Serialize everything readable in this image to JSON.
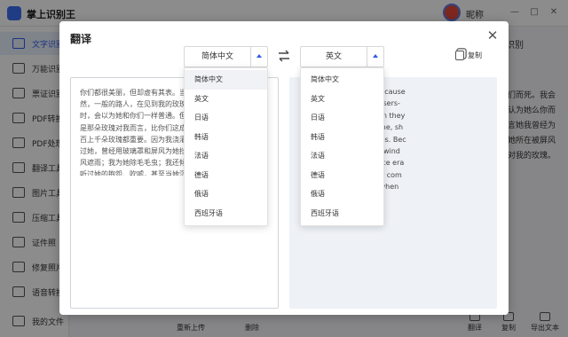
{
  "app": {
    "title": "掌上识别王",
    "user_name": "昵称",
    "window_buttons": [
      "—",
      "□",
      "✕"
    ]
  },
  "sidebar": {
    "items": [
      {
        "label": "文字识别",
        "icon": "text-recognition-icon",
        "active": true
      },
      {
        "label": "万能识别",
        "icon": "universal-recognition-icon"
      },
      {
        "label": "票证识别",
        "icon": "ticket-recognition-icon"
      },
      {
        "label": "PDF转换",
        "icon": "pdf-convert-icon"
      },
      {
        "label": "PDF处理",
        "icon": "pdf-process-icon"
      },
      {
        "label": "翻译工具",
        "icon": "translate-tool-icon"
      },
      {
        "label": "图片工具",
        "icon": "image-tool-icon"
      },
      {
        "label": "压缩工具",
        "icon": "compress-tool-icon"
      },
      {
        "label": "证件照",
        "icon": "id-photo-icon"
      },
      {
        "label": "修复照片",
        "icon": "photo-repair-icon"
      },
      {
        "label": "语音转换",
        "icon": "voice-convert-icon"
      }
    ],
    "bottom_label": "我的文件"
  },
  "main": {
    "tab_right": "识别",
    "right_panel_text": "们而死。我会认为她么你而言她我曾经为她所在被屏风对我的玫瑰。",
    "bottom": {
      "reupload": "重新上传",
      "delete": "删除",
      "translate": "翻译",
      "copy": "复制",
      "export": "导出文本"
    }
  },
  "modal": {
    "title": "翻译",
    "copy_label": "复制",
    "source_lang": "简体中文",
    "target_lang": "英文",
    "source_text": "你们都很美丽，但却虚有其表。当然，一般的路人，在见到我的玫瑰时，会以为她和你们一样普通。但是那朵玫瑰对我而言，比你们这成百上千朵玫瑰都重要。因为我浇灌过她，曾经用玻璃罩和屏风为她挡风遮雨；我为她除毛毛虫；我还倾听过她的抱怨、吹嘘，甚至当她沉默不语的时候倾听她，因为她是我的玫瑰。",
    "target_text": "t you are superficial. Because Of course, ordinary passers-es ordinary as you when they se belongs to me. For me, sh n your hundreds of roses. Bec , shielded her from the wind ver and screen, and once era er; I also listened to her com and accompanied her when ause she was my rose.",
    "target_lines": [
      "t you are superficial. Because",
      "Of course, ordinary passers-",
      "es ordinary as you when they",
      "se belongs to me. For me, sh",
      "n your hundreds of roses. Bec",
      ", shielded her from the wind",
      "ver and screen, and once era",
      "er; I also listened to her com",
      "and accompanied her when",
      "ause she was my rose."
    ],
    "language_options": [
      "简体中文",
      "英文",
      "日语",
      "韩语",
      "法语",
      "德语",
      "俄语",
      "西班牙语"
    ]
  },
  "colors": {
    "accent": "#2f5bea",
    "overlay": "rgba(0,0,0,0.45)",
    "target_bg": "#eef1f6"
  }
}
